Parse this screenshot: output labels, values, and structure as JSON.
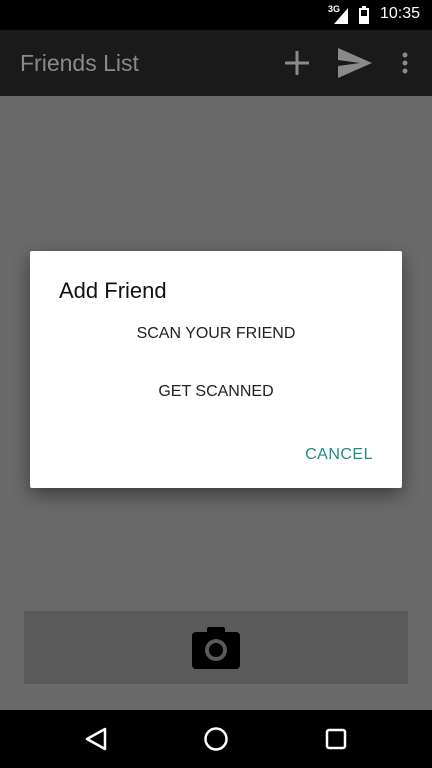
{
  "status_bar": {
    "network": "3G",
    "time": "10:35"
  },
  "app_bar": {
    "title": "Friends List",
    "actions": [
      {
        "icon": "add-icon"
      },
      {
        "icon": "send-icon"
      },
      {
        "icon": "overflow-menu-icon"
      }
    ]
  },
  "dialog": {
    "title": "Add Friend",
    "options": [
      "SCAN YOUR FRIEND",
      "GET SCANNED"
    ],
    "cancel_label": "CANCEL"
  },
  "bottom_bar": {
    "icon": "camera-icon"
  },
  "nav_bar": {
    "buttons": [
      "back-icon",
      "home-icon",
      "recents-icon"
    ]
  },
  "colors": {
    "accent": "#1f8c84",
    "app_bar": "#1a1a1a",
    "scrim": "#6a6a6a"
  }
}
